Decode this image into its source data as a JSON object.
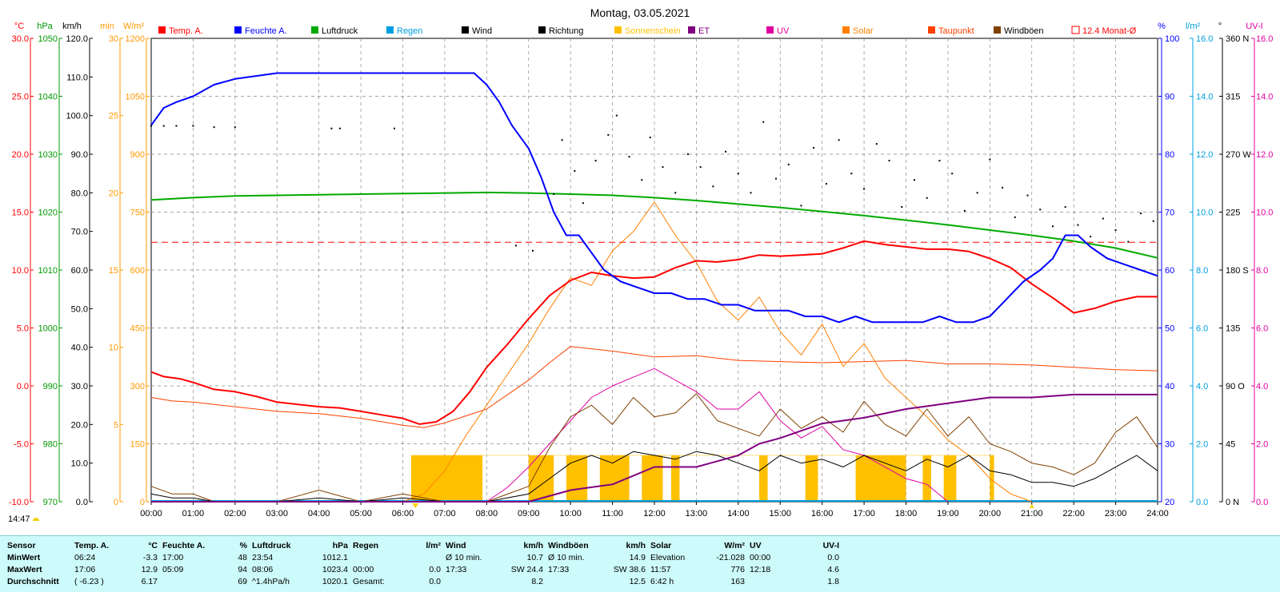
{
  "chart_data": {
    "type": "line",
    "title": "Montag, 03.05.2021",
    "x_ticks": [
      "00:00",
      "01:00",
      "02:00",
      "03:00",
      "04:00",
      "05:00",
      "06:00",
      "07:00",
      "08:00",
      "09:00",
      "10:00",
      "11:00",
      "12:00",
      "13:00",
      "14:00",
      "15:00",
      "16:00",
      "17:00",
      "18:00",
      "19:00",
      "20:00",
      "21:00",
      "22:00",
      "23:00",
      "24:00"
    ],
    "grid": true,
    "legend": [
      {
        "name": "Temp. A.",
        "color": "#ff0000"
      },
      {
        "name": "Feuchte A.",
        "color": "#0000ff"
      },
      {
        "name": "Luftdruck",
        "color": "#00aa00"
      },
      {
        "name": "Regen",
        "color": "#00a0e0"
      },
      {
        "name": "Wind",
        "color": "#000000"
      },
      {
        "name": "Richtung",
        "color": "#000000"
      },
      {
        "name": "Sonnenschein",
        "color": "#ffc000"
      },
      {
        "name": "ET",
        "color": "#800080"
      },
      {
        "name": "UV",
        "color": "#e000a0"
      },
      {
        "name": "Solar",
        "color": "#ff8000"
      },
      {
        "name": "Taupunkt",
        "color": "#ff4000"
      },
      {
        "name": "Windböen",
        "color": "#804000"
      },
      {
        "name": "12.4 Monat-Ø",
        "color": "#ff0000"
      }
    ],
    "left_axes": [
      {
        "unit": "°C",
        "color": "#ff0000",
        "ticks": [
          "30.0",
          "25.0",
          "20.0",
          "15.0",
          "10.0",
          "5.0",
          "0.0",
          "-5.0",
          "-10.0"
        ]
      },
      {
        "unit": "hPa",
        "color": "#009900",
        "ticks": [
          "1050",
          "1040",
          "1030",
          "1020",
          "1010",
          "1000",
          "990",
          "980",
          "970"
        ]
      },
      {
        "unit": "km/h",
        "color": "#000000",
        "ticks": [
          "120.0",
          "110.0",
          "100.0",
          "90.0",
          "80.0",
          "70.0",
          "60.0",
          "50.0",
          "40.0",
          "30.0",
          "20.0",
          "10.0",
          "0.0"
        ]
      },
      {
        "unit": "min",
        "color": "#ff9900",
        "ticks": [
          "30",
          "25",
          "20",
          "15",
          "10",
          "5",
          "0"
        ]
      },
      {
        "unit": "W/m²",
        "color": "#ff9900",
        "ticks": [
          "1200",
          "1050",
          "900",
          "750",
          "600",
          "450",
          "300",
          "150",
          "0"
        ]
      }
    ],
    "right_axes": [
      {
        "unit": "%",
        "color": "#0000ff",
        "ticks": [
          "100",
          "90",
          "80",
          "70",
          "60",
          "50",
          "40",
          "30",
          "20"
        ]
      },
      {
        "unit": "l/m²",
        "color": "#00a0e0",
        "ticks": [
          "16.0",
          "14.0",
          "12.0",
          "10.0",
          "8.0",
          "6.0",
          "4.0",
          "2.0",
          "0.0"
        ]
      },
      {
        "unit": "°",
        "color": "#000000",
        "ticks": [
          "360 N",
          "315",
          "270 W",
          "225",
          "180 S",
          "135",
          "90 O",
          "45",
          "0 N"
        ]
      },
      {
        "unit": "UV-I",
        "color": "#e000a0",
        "ticks": [
          "16.0",
          "14.0",
          "12.0",
          "10.0",
          "8.0",
          "6.0",
          "4.0",
          "2.0",
          "0.0"
        ]
      }
    ],
    "monthly_avg_temp": 12.4,
    "series": [
      {
        "name": "Temp. A.",
        "x": [
          0,
          0.3,
          0.7,
          1,
          1.5,
          2,
          2.5,
          3,
          3.5,
          4,
          4.5,
          5,
          5.5,
          6,
          6.4,
          6.8,
          7.2,
          7.6,
          8,
          8.5,
          9,
          9.5,
          10,
          10.5,
          11,
          11.5,
          12,
          12.5,
          13,
          13.5,
          14,
          14.5,
          15,
          15.5,
          16,
          16.5,
          17,
          17.5,
          18,
          18.5,
          19,
          19.5,
          20,
          20.5,
          21,
          21.5,
          22,
          22.5,
          23,
          23.5,
          24
        ],
        "values": [
          1.2,
          0.8,
          0.6,
          0.3,
          -0.3,
          -0.5,
          -0.9,
          -1.4,
          -1.6,
          -1.8,
          -1.9,
          -2.2,
          -2.5,
          -2.8,
          -3.3,
          -3.1,
          -2.2,
          -0.5,
          1.6,
          3.6,
          5.8,
          7.8,
          9.1,
          9.8,
          9.5,
          9.3,
          9.4,
          10.2,
          10.8,
          10.7,
          10.9,
          11.3,
          11.2,
          11.3,
          11.4,
          11.9,
          12.5,
          12.2,
          12.0,
          11.8,
          11.8,
          11.6,
          11.0,
          10.2,
          8.8,
          7.6,
          6.3,
          6.7,
          7.3,
          7.7,
          7.7
        ]
      },
      {
        "name": "Feuchte A.",
        "x": [
          0,
          0.3,
          0.6,
          1,
          1.5,
          2,
          3,
          4,
          5,
          6,
          7,
          7.7,
          8,
          8.3,
          8.6,
          9,
          9.3,
          9.6,
          9.9,
          10.2,
          10.5,
          10.8,
          11.2,
          11.6,
          12,
          12.4,
          12.8,
          13.2,
          13.6,
          14,
          14.4,
          14.8,
          15.2,
          15.6,
          16,
          16.4,
          16.8,
          17.2,
          17.6,
          18,
          18.4,
          18.8,
          19.2,
          19.6,
          20,
          20.4,
          20.8,
          21.2,
          21.5,
          21.8,
          22.1,
          22.4,
          22.8,
          23.2,
          23.6,
          24
        ],
        "values": [
          85,
          88,
          89,
          90,
          92,
          93,
          94,
          94,
          94,
          94,
          94,
          94,
          92,
          89,
          85,
          81,
          76,
          70,
          66,
          66,
          63,
          60,
          58,
          57,
          56,
          56,
          55,
          55,
          54,
          54,
          53,
          53,
          53,
          52,
          52,
          51,
          52,
          51,
          51,
          51,
          51,
          52,
          51,
          51,
          52,
          55,
          58,
          60,
          62,
          66,
          66,
          64,
          62,
          61,
          60,
          59
        ]
      },
      {
        "name": "Luftdruck",
        "x": [
          0,
          1,
          2,
          3,
          4,
          5,
          6,
          7,
          8,
          9,
          10,
          11,
          12,
          13,
          14,
          15,
          16,
          17,
          18,
          19,
          20,
          21,
          22,
          23,
          24
        ],
        "values": [
          1022.1,
          1022.5,
          1022.8,
          1022.9,
          1023.0,
          1023.1,
          1023.2,
          1023.3,
          1023.4,
          1023.3,
          1023.1,
          1022.9,
          1022.5,
          1022.0,
          1021.4,
          1020.8,
          1020.1,
          1019.4,
          1018.6,
          1017.8,
          1016.9,
          1016.0,
          1015.0,
          1013.8,
          1012.1
        ]
      },
      {
        "name": "Wind",
        "x": [
          0,
          0.5,
          1,
          1.5,
          2,
          3,
          4,
          5,
          6,
          7,
          8,
          9,
          9.5,
          10,
          10.5,
          11,
          11.5,
          12,
          12.5,
          13,
          13.5,
          14,
          14.5,
          15,
          15.5,
          16,
          16.5,
          17,
          17.5,
          18,
          18.5,
          19,
          19.5,
          20,
          20.5,
          21,
          21.5,
          22,
          22.5,
          23,
          23.5,
          24
        ],
        "values": [
          2,
          1,
          1,
          0,
          0,
          0,
          1,
          0,
          1,
          0,
          0,
          2,
          6,
          10,
          12,
          10,
          13,
          12,
          11,
          13,
          12,
          10,
          8,
          12,
          10,
          11,
          9,
          12,
          10,
          8,
          11,
          9,
          12,
          8,
          7,
          5,
          5,
          4,
          6,
          9,
          12,
          8
        ]
      },
      {
        "name": "Windböen",
        "x": [
          0,
          0.5,
          1,
          1.5,
          2,
          3,
          4,
          5,
          6,
          7,
          8,
          9,
          9.5,
          10,
          10.5,
          11,
          11.5,
          12,
          12.5,
          13,
          13.5,
          14,
          14.5,
          15,
          15.5,
          16,
          16.5,
          17,
          17.5,
          18,
          18.5,
          19,
          19.5,
          20,
          20.5,
          21,
          21.5,
          22,
          22.5,
          23,
          23.5,
          24
        ],
        "values": [
          4,
          2,
          2,
          0,
          0,
          0,
          3,
          0,
          2,
          0,
          0,
          4,
          14,
          22,
          25,
          20,
          27,
          22,
          23,
          28,
          21,
          19,
          17,
          24,
          19,
          22,
          18,
          26,
          20,
          17,
          24,
          17,
          22,
          15,
          13,
          10,
          9,
          7,
          10,
          18,
          22,
          14
        ]
      },
      {
        "name": "Solar",
        "x": [
          6,
          6.5,
          7,
          7.5,
          8,
          8.5,
          9,
          9.5,
          10,
          10.5,
          11,
          11.5,
          12,
          12.5,
          13,
          13.5,
          14,
          14.5,
          15,
          15.5,
          16,
          16.5,
          17,
          17.5,
          18,
          18.5,
          19,
          19.5,
          20,
          20.5,
          21
        ],
        "values": [
          0,
          20,
          80,
          170,
          250,
          330,
          410,
          500,
          580,
          560,
          650,
          700,
          776,
          690,
          620,
          520,
          470,
          530,
          440,
          380,
          460,
          350,
          410,
          320,
          270,
          220,
          160,
          120,
          60,
          20,
          0
        ]
      },
      {
        "name": "UV",
        "x": [
          8,
          8.5,
          9,
          9.5,
          10,
          10.5,
          11,
          11.5,
          12,
          12.5,
          13,
          13.5,
          14,
          14.5,
          15,
          15.5,
          16,
          16.5,
          17,
          17.5,
          18,
          18.5,
          19
        ],
        "values": [
          0,
          0.5,
          1.2,
          2.0,
          2.8,
          3.6,
          4.0,
          4.3,
          4.6,
          4.2,
          3.8,
          3.2,
          3.2,
          3.8,
          2.8,
          2.2,
          2.6,
          1.8,
          1.6,
          1.2,
          0.8,
          0.6,
          0
        ]
      },
      {
        "name": "ET",
        "x": [
          0,
          9,
          10,
          10.5,
          11,
          12,
          13,
          13.5,
          14,
          14.5,
          15,
          16,
          17,
          18,
          19,
          20,
          21,
          22,
          23,
          24
        ],
        "values": [
          0,
          0,
          0.4,
          0.5,
          0.6,
          1.2,
          1.2,
          1.4,
          1.6,
          2.0,
          2.2,
          2.7,
          2.9,
          3.2,
          3.4,
          3.6,
          3.6,
          3.7,
          3.7,
          3.7
        ]
      },
      {
        "name": "Taupunkt",
        "x": [
          0,
          0.5,
          1,
          2,
          3,
          4,
          5,
          6,
          6.5,
          7,
          8,
          9,
          9.5,
          10,
          10.5,
          11,
          12,
          13,
          14,
          15,
          16,
          17,
          18,
          19,
          20,
          21,
          22,
          23,
          24
        ],
        "values": [
          -1.0,
          -1.3,
          -1.4,
          -1.8,
          -2.2,
          -2.4,
          -2.8,
          -3.4,
          -3.6,
          -3.2,
          -2.0,
          0.5,
          2.0,
          3.4,
          3.2,
          3.0,
          2.5,
          2.6,
          2.2,
          2.1,
          2.0,
          2.1,
          2.2,
          1.9,
          1.9,
          1.8,
          1.6,
          1.4,
          1.3
        ]
      },
      {
        "name": "Richtung",
        "x": [
          0,
          0.3,
          0.6,
          1,
          1.5,
          2,
          4.3,
          4.5,
          5.8,
          8.7,
          9.1,
          9.6,
          9.8,
          10.1,
          10.3,
          10.6,
          10.9,
          11.1,
          11.4,
          11.7,
          11.9,
          12.2,
          12.5,
          12.8,
          13.1,
          13.4,
          13.7,
          14.0,
          14.3,
          14.6,
          14.9,
          15.2,
          15.5,
          15.8,
          16.1,
          16.4,
          16.7,
          17.0,
          17.3,
          17.6,
          17.9,
          18.2,
          18.5,
          18.8,
          19.1,
          19.4,
          19.7,
          20.0,
          20.3,
          20.6,
          20.9,
          21.2,
          21.5,
          21.8,
          22.1,
          22.4,
          22.7,
          23.0,
          23.3,
          23.6,
          23.9
        ],
        "values": [
          292,
          292,
          292,
          292,
          291,
          291,
          290,
          290,
          290,
          199,
          195,
          239,
          281,
          257,
          232,
          265,
          285,
          300,
          268,
          250,
          283,
          260,
          240,
          270,
          260,
          245,
          272,
          255,
          240,
          295,
          251,
          262,
          230,
          275,
          247,
          281,
          255,
          243,
          278,
          265,
          229,
          250,
          236,
          265,
          255,
          226,
          240,
          266,
          244,
          221,
          238,
          227,
          214,
          229,
          215,
          206,
          220,
          211,
          202,
          224,
          218
        ]
      }
    ],
    "sunshine_spans_hours": [
      [
        6.2,
        7.9
      ],
      [
        9.0,
        9.6
      ],
      [
        9.9,
        10.4
      ],
      [
        10.7,
        11.4
      ],
      [
        11.7,
        12.2
      ],
      [
        12.4,
        12.6
      ],
      [
        14.5,
        14.7
      ],
      [
        15.6,
        15.9
      ],
      [
        16.8,
        18.0
      ],
      [
        18.4,
        18.6
      ],
      [
        18.9,
        19.2
      ],
      [
        20.0,
        20.1
      ]
    ],
    "min_marker_hour": 6.3,
    "max_marker_hour": 21.0
  },
  "status": {
    "time": "14:47"
  },
  "stats": {
    "headers": {
      "sensor": "Sensor",
      "temp": "Temp. A.",
      "temp_unit": "°C",
      "hum": "Feuchte A.",
      "hum_unit": "%",
      "press": "Luftdruck",
      "press_unit": "hPa",
      "rain": "Regen",
      "rain_unit": "l/m²",
      "wind": "Wind",
      "wind_unit": "km/h",
      "gust": "Windböen",
      "gust_unit": "km/h",
      "solar": "Solar",
      "solar_unit": "W/m²",
      "uv": "UV",
      "uv_unit": "UV-I"
    },
    "min": {
      "label": "MinWert",
      "temp_time": "06:24",
      "temp": "-3.3",
      "hum_time": "17:00",
      "hum": "48",
      "press_time": "23:54",
      "press": "1012.1",
      "rain_time": "",
      "rain": "",
      "wind_label": "Ø 10 min.",
      "wind": "10.7",
      "gust_label": "Ø 10 min.",
      "gust": "14.9",
      "solar_label": "Elevation",
      "solar": "-21.028",
      "uv_time": "00:00",
      "uv": "0.0"
    },
    "max": {
      "label": "MaxWert",
      "temp_time": "17:06",
      "temp": "12.9",
      "hum_time": "05:09",
      "hum": "94",
      "press_time": "08:06",
      "press": "1023.4",
      "rain_time": "00:00",
      "rain": "0.0",
      "wind_time": "17:33",
      "wind": "SW 24.4",
      "gust_time": "17:33",
      "gust": "SW 38.6",
      "solar_time": "11:57",
      "solar": "776",
      "uv_time": "12:18",
      "uv": "4.6"
    },
    "avg": {
      "label": "Durchschnitt",
      "temp_extra": "( -6.23 )",
      "temp": "6.17",
      "hum": "69",
      "press_trend": "^1.4hPa/h",
      "press": "1020.1",
      "rain_label": "Gesamt:",
      "rain": "0.0",
      "wind": "8.2",
      "gust": "12.5",
      "solar_extra": "6:42 h",
      "solar": "163",
      "uv": "1.8"
    }
  }
}
